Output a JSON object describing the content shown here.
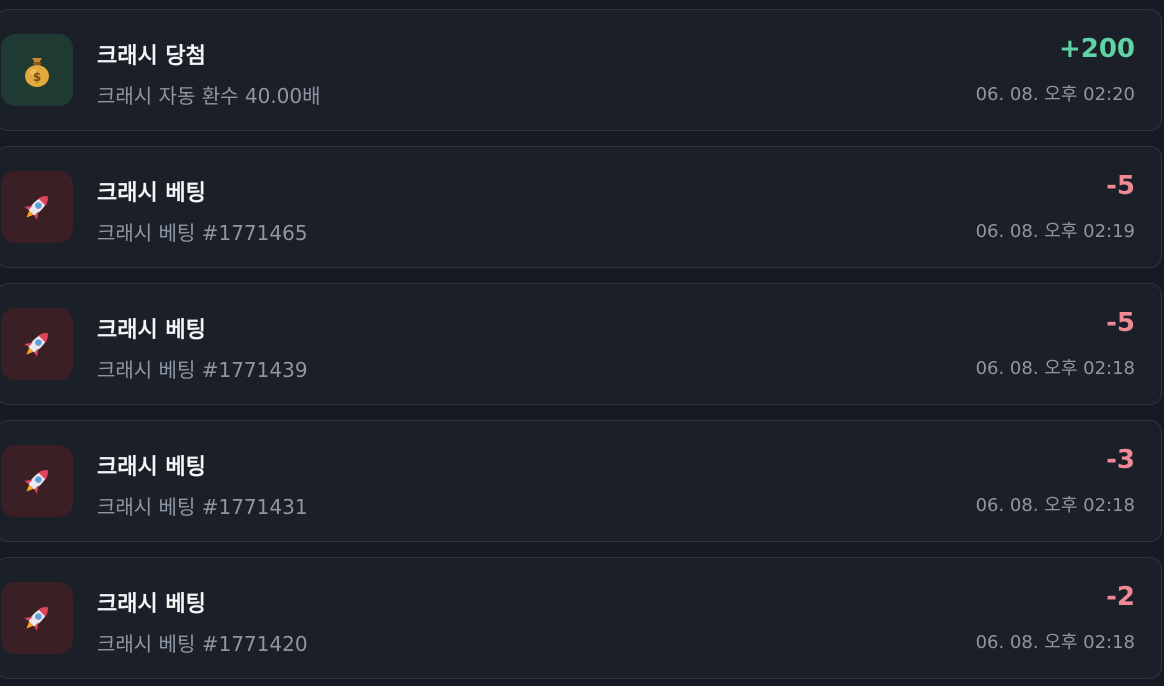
{
  "transactions": [
    {
      "type": "win",
      "icon": "money-bag-icon",
      "title": "크래시 당첨",
      "subtitle": "크래시 자동 환수 40.00배",
      "amount": "+200",
      "time": "06. 08. 오후 02:20"
    },
    {
      "type": "bet",
      "icon": "rocket-icon",
      "title": "크래시 베팅",
      "subtitle": "크래시 베팅 #1771465",
      "amount": "-5",
      "time": "06. 08. 오후 02:19"
    },
    {
      "type": "bet",
      "icon": "rocket-icon",
      "title": "크래시 베팅",
      "subtitle": "크래시 베팅 #1771439",
      "amount": "-5",
      "time": "06. 08. 오후 02:18"
    },
    {
      "type": "bet",
      "icon": "rocket-icon",
      "title": "크래시 베팅",
      "subtitle": "크래시 베팅 #1771431",
      "amount": "-3",
      "time": "06. 08. 오후 02:18"
    },
    {
      "type": "bet",
      "icon": "rocket-icon",
      "title": "크래시 베팅",
      "subtitle": "크래시 베팅 #1771420",
      "amount": "-2",
      "time": "06. 08. 오후 02:18"
    }
  ],
  "colors": {
    "background": "#161a22",
    "card": "#1b1f28",
    "positive": "#5fd3a5",
    "negative": "#f08896",
    "win_icon_bg": "#1e3a33",
    "bet_icon_bg": "#3a1f24"
  }
}
